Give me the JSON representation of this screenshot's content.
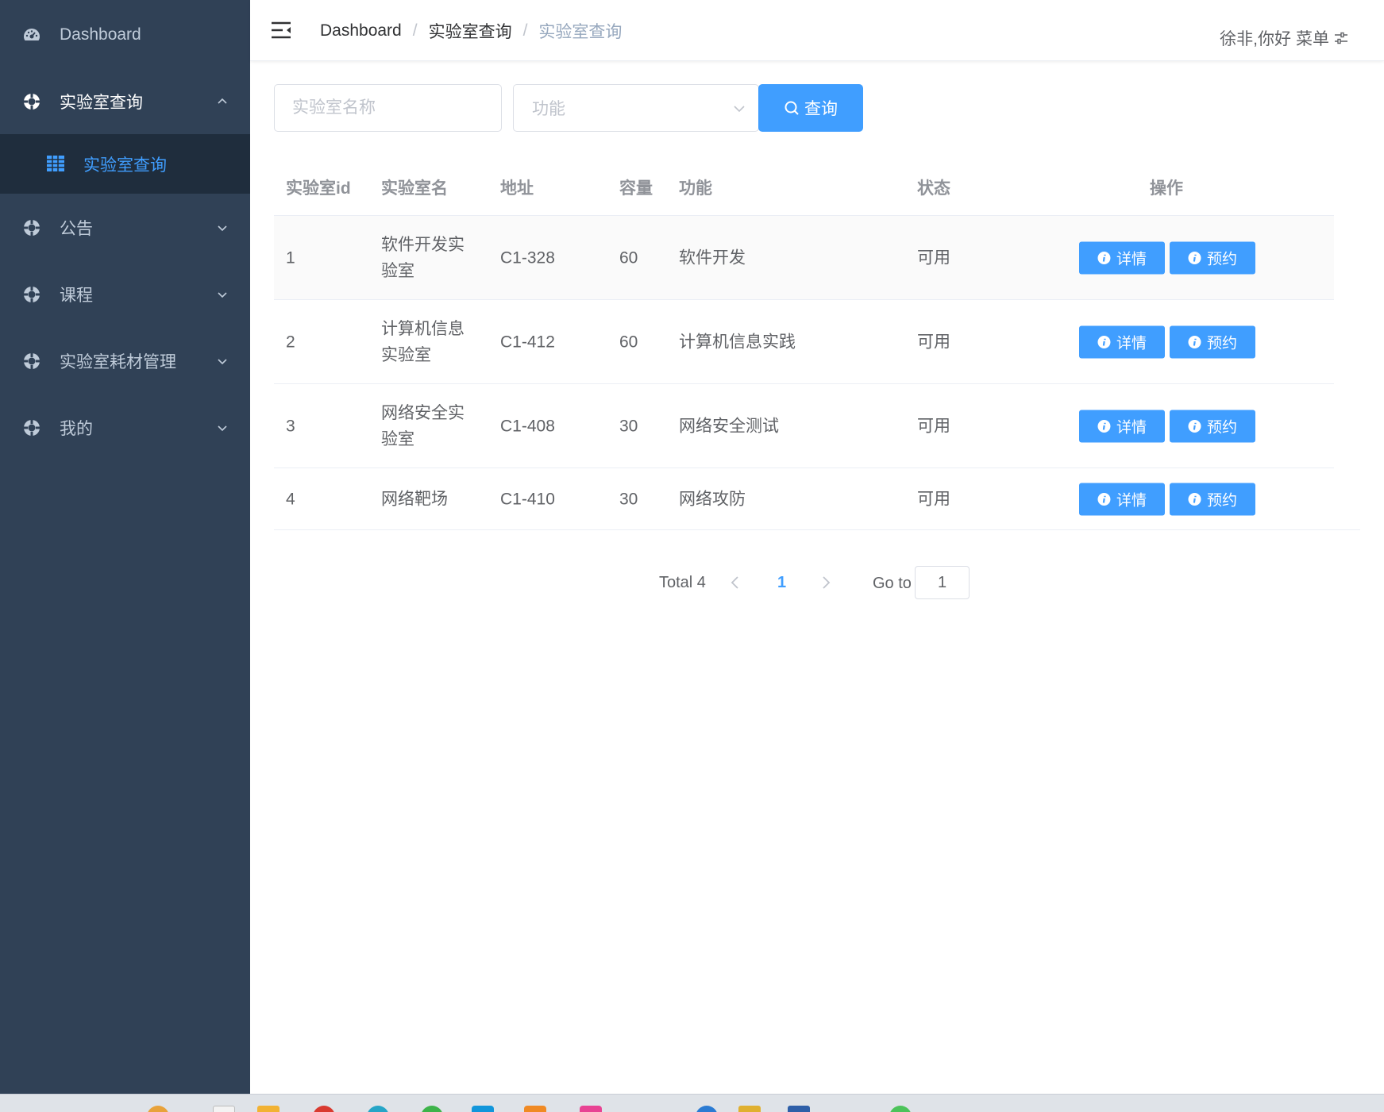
{
  "sidebar": {
    "items": [
      {
        "label": "Dashboard",
        "icon": "dashboard-icon"
      },
      {
        "label": "实验室查询",
        "icon": "lifebuoy-icon",
        "expanded": true
      },
      {
        "label": "公告",
        "icon": "lifebuoy-icon"
      },
      {
        "label": "课程",
        "icon": "lifebuoy-icon"
      },
      {
        "label": "实验室耗材管理",
        "icon": "lifebuoy-icon"
      },
      {
        "label": "我的",
        "icon": "lifebuoy-icon"
      }
    ],
    "submenu": {
      "label": "实验室查询",
      "icon": "table-icon",
      "active": true
    }
  },
  "navbar": {
    "breadcrumb": [
      "Dashboard",
      "实验室查询",
      "实验室查询"
    ],
    "separator": "/",
    "greeting": "徐非,你好",
    "menu_label": "菜单"
  },
  "search": {
    "name_placeholder": "实验室名称",
    "function_placeholder": "功能",
    "button_label": "查询"
  },
  "table": {
    "columns": [
      "实验室id",
      "实验室名",
      "地址",
      "容量",
      "功能",
      "状态",
      "操作"
    ],
    "rows": [
      {
        "id": "1",
        "name": "软件开发实验室",
        "address": "C1-328",
        "capacity": "60",
        "function": "软件开发",
        "status": "可用"
      },
      {
        "id": "2",
        "name": "计算机信息实验室",
        "address": "C1-412",
        "capacity": "60",
        "function": "计算机信息实践",
        "status": "可用"
      },
      {
        "id": "3",
        "name": "网络安全实验室",
        "address": "C1-408",
        "capacity": "30",
        "function": "网络安全测试",
        "status": "可用"
      },
      {
        "id": "4",
        "name": "网络靶场",
        "address": "C1-410",
        "capacity": "30",
        "function": "网络攻防",
        "status": "可用"
      }
    ],
    "detail_label": "详情",
    "reserve_label": "预约"
  },
  "pagination": {
    "total_label": "Total 4",
    "current_page": "1",
    "goto_label": "Go to",
    "goto_value": "1"
  },
  "colors": {
    "sidebar_bg": "#304156",
    "submenu_bg": "#1f2d3d",
    "primary": "#409eff"
  }
}
